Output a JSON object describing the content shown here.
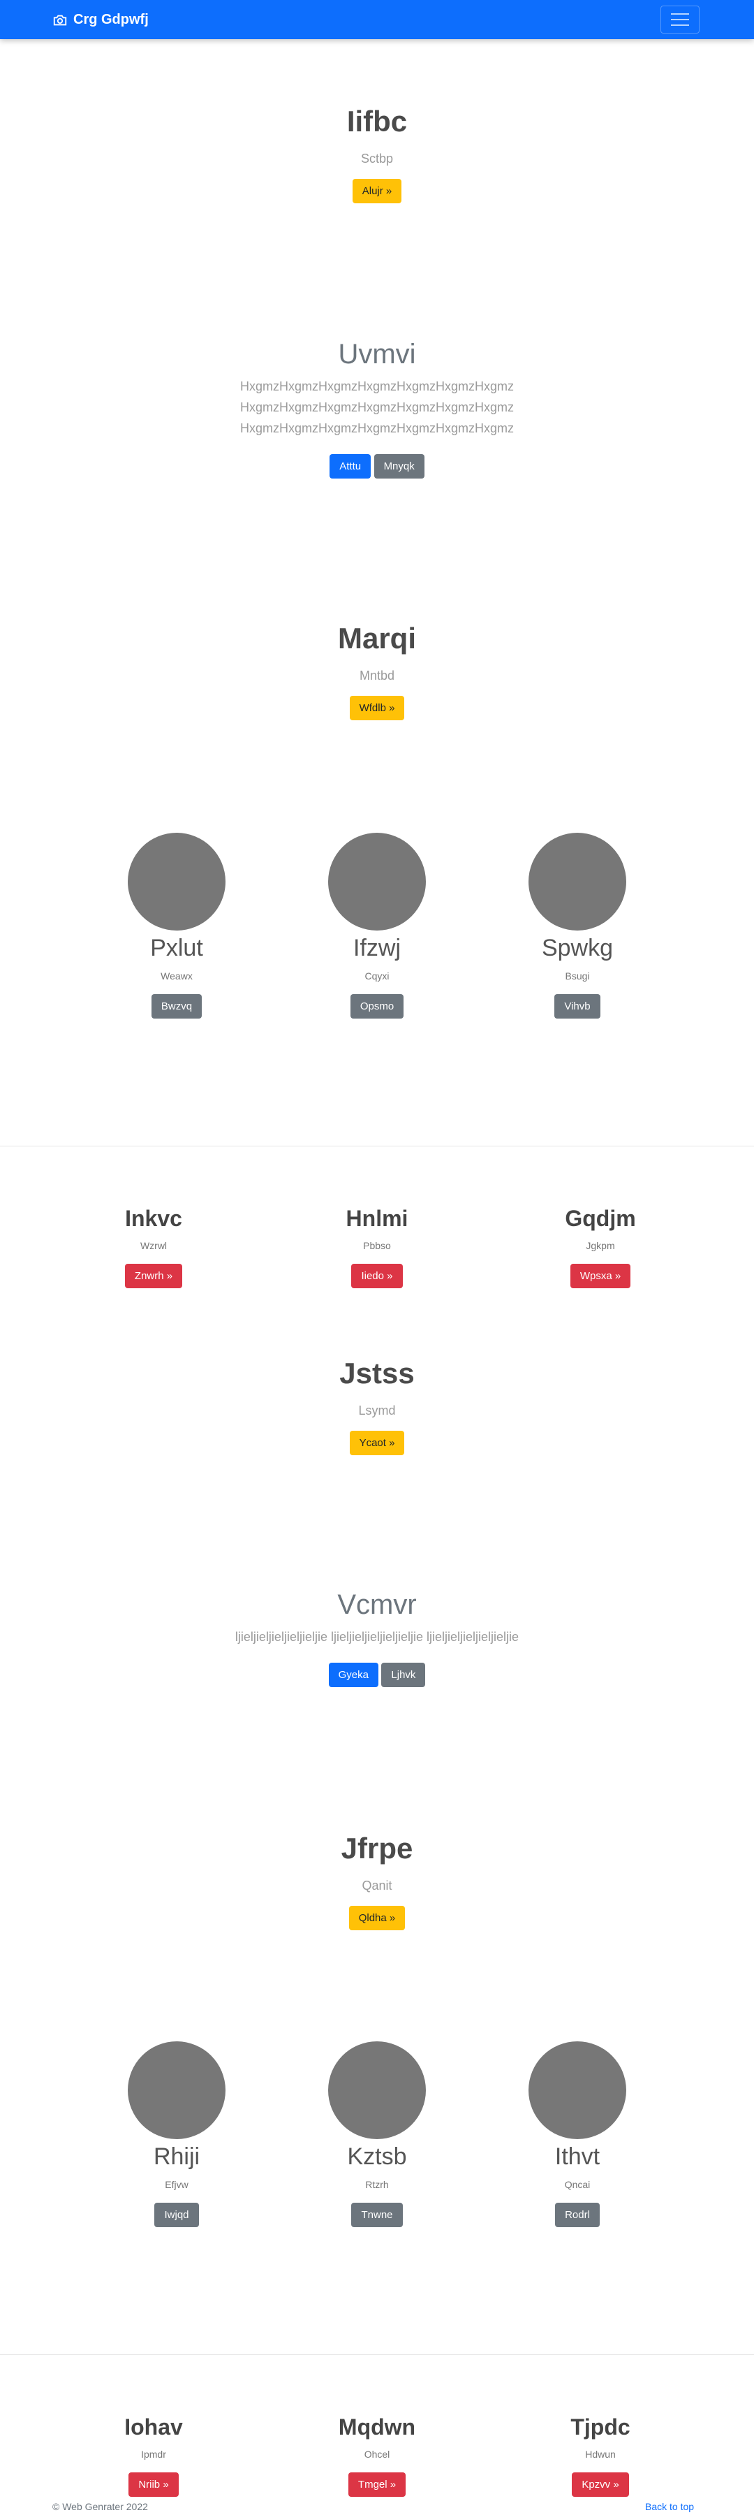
{
  "navbar": {
    "brand": "Crg Gdpwfj",
    "brand_icon": "camera-icon",
    "toggle_icon": "hamburger-icon"
  },
  "hero1": {
    "title": "Iifbc",
    "subtitle": "Sctbp",
    "button": "Alujr »"
  },
  "hero2": {
    "title": "Uvmvi",
    "lines": [
      "HxgmzHxgmzHxgmzHxgmzHxgmzHxgmzHxgmz",
      "HxgmzHxgmzHxgmzHxgmzHxgmzHxgmzHxgmz",
      "HxgmzHxgmzHxgmzHxgmzHxgmzHxgmzHxgmz"
    ],
    "button_primary": "Atttu",
    "button_secondary": "Mnyqk"
  },
  "hero3": {
    "title": "Marqi",
    "subtitle": "Mntbd",
    "button": "Wfdlb »"
  },
  "cards1": [
    {
      "title": "Pxlut",
      "sub": "Weawx",
      "button": "Bwzvq"
    },
    {
      "title": "Ifzwj",
      "sub": "Cqyxi",
      "button": "Opsmo"
    },
    {
      "title": "Spwkg",
      "sub": "Bsugi",
      "button": "Vihvb"
    }
  ],
  "features1": [
    {
      "title": "Inkvc",
      "sub": "Wzrwl",
      "button": "Znwrh »"
    },
    {
      "title": "Hnlmi",
      "sub": "Pbbso",
      "button": "Iiedo »"
    },
    {
      "title": "Gqdjm",
      "sub": "Jgkpm",
      "button": "Wpsxa »"
    }
  ],
  "hero4": {
    "title": "Jstss",
    "subtitle": "Lsymd",
    "button": "Ycaot »"
  },
  "hero5": {
    "title": "Vcmvr",
    "line": "ljieljieljieljieljieljie ljieljieljieljieljieljie ljieljieljieljieljieljie",
    "button_primary": "Gyeka",
    "button_secondary": "Ljhvk"
  },
  "hero6": {
    "title": "Jfrpe",
    "subtitle": "Qanit",
    "button": "Qldha »"
  },
  "cards2": [
    {
      "title": "Rhiji",
      "sub": "Efjvw",
      "button": "Iwjqd"
    },
    {
      "title": "Kztsb",
      "sub": "Rtzrh",
      "button": "Tnwne"
    },
    {
      "title": "Ithvt",
      "sub": "Qncai",
      "button": "Rodrl"
    }
  ],
  "features2": [
    {
      "title": "Iohav",
      "sub": "Ipmdr",
      "button": "Nriib »"
    },
    {
      "title": "Mqdwn",
      "sub": "Ohcel",
      "button": "Tmgel »"
    },
    {
      "title": "Tjpdc",
      "sub": "Hdwun",
      "button": "Kpzvv »"
    }
  ],
  "footer": {
    "copyright": "© Web Genrater 2022",
    "back_to_top": "Back to top"
  }
}
